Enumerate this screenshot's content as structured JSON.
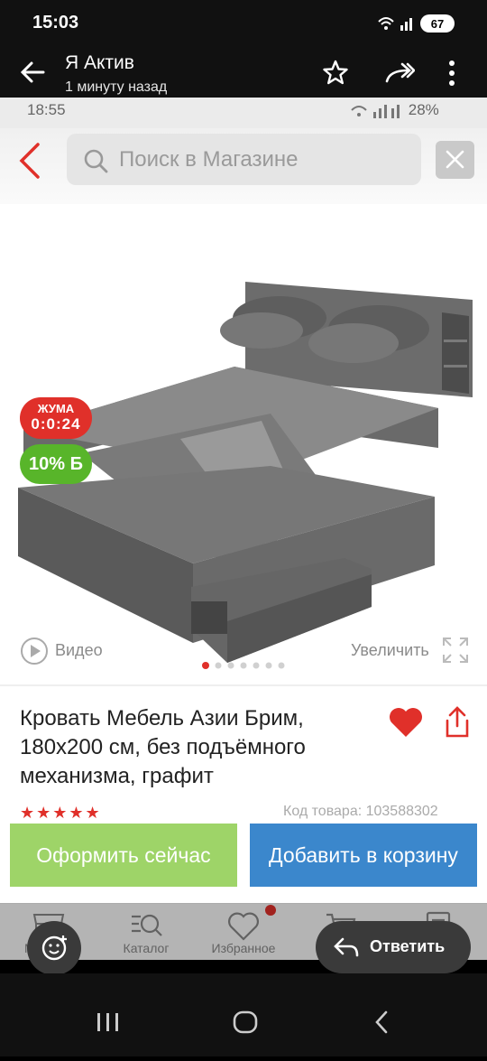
{
  "status_bar": {
    "time": "15:03",
    "battery": "67"
  },
  "chat_header": {
    "title": "Я Актив",
    "subtitle": "1 минуту назад"
  },
  "screenshot": {
    "status": {
      "time": "18:55",
      "battery": "28%"
    },
    "search": {
      "placeholder": "Поиск в Магазине"
    },
    "product": {
      "badge_day_line1": "ЖУМА",
      "badge_day_line2": "0:0:24",
      "badge_discount": "10% Б",
      "video_label": "Видео",
      "zoom_label": "Увеличить",
      "title": "Кровать Мебель Азии Брим, 180x200 см, без подъёмного механизма, графит",
      "stars": "★★★★★",
      "code": "Код товара: 103588302"
    },
    "buttons": {
      "buy_now": "Оформить сейчас",
      "add_to_cart": "Добавить в корзину"
    },
    "nav": {
      "items": [
        "Магазин",
        "Каталог",
        "Избранное",
        "Корзина",
        "Заказы"
      ]
    }
  },
  "overlay": {
    "reply": "Ответить"
  },
  "colors": {
    "accent_red": "#e0302a",
    "green_button": "#9ed468",
    "blue_button": "#3b87cc",
    "discount_green": "#58b52a"
  },
  "icons": [
    "back-arrow-icon",
    "star-icon",
    "forward-icon",
    "more-icon",
    "search-icon",
    "close-icon",
    "video-play-icon",
    "expand-icon",
    "heart-icon",
    "share-icon",
    "store-icon",
    "catalog-icon",
    "favorites-icon",
    "cart-icon",
    "orders-icon",
    "emoji-icon",
    "reply-icon"
  ]
}
